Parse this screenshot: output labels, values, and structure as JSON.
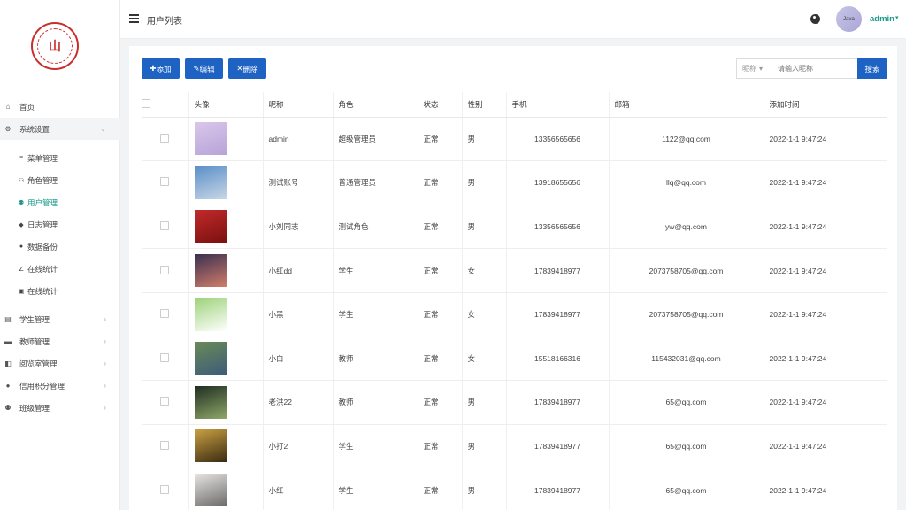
{
  "sidebar": {
    "logo_text": "山",
    "menu": [
      {
        "label": "首页",
        "icon": "home-icon",
        "glyph": "⌂",
        "has_arrow": false
      },
      {
        "label": "系统设置",
        "icon": "gear-icon",
        "glyph": "⚙",
        "has_arrow": true,
        "expanded": true
      }
    ],
    "sub_items": [
      {
        "label": "菜单管理",
        "icon": "list-icon",
        "glyph": "≡",
        "active": false
      },
      {
        "label": "角色管理",
        "icon": "user-group-icon",
        "glyph": "⚇",
        "active": false
      },
      {
        "label": "用户管理",
        "icon": "users-icon",
        "glyph": "⚉",
        "active": true
      },
      {
        "label": "日志管理",
        "icon": "tag-icon",
        "glyph": "◆",
        "active": false
      },
      {
        "label": "数据备份",
        "icon": "database-icon",
        "glyph": "●",
        "active": false
      },
      {
        "label": "在线统计",
        "icon": "chart-line-icon",
        "glyph": "∠",
        "active": false
      },
      {
        "label": "在线统计",
        "icon": "monitor-icon",
        "glyph": "▣",
        "active": false
      }
    ],
    "menu_after": [
      {
        "label": "学生管理",
        "icon": "student-icon",
        "glyph": "▤"
      },
      {
        "label": "教师管理",
        "icon": "teacher-icon",
        "glyph": "▬"
      },
      {
        "label": "阅览室管理",
        "icon": "room-icon",
        "glyph": "◧"
      },
      {
        "label": "信用积分管理",
        "icon": "person-icon",
        "glyph": "●"
      },
      {
        "label": "班级管理",
        "icon": "class-icon",
        "glyph": "⚉"
      }
    ]
  },
  "header": {
    "title": "用户列表",
    "avatar_text": "Java",
    "user": "admin"
  },
  "toolbar": {
    "add_label": "添加",
    "edit_label": "编辑",
    "delete_label": "删除",
    "search_field": "昵称",
    "search_placeholder": "请输入昵称",
    "search_label": "搜索"
  },
  "table": {
    "columns": [
      "头像",
      "昵称",
      "角色",
      "状态",
      "性别",
      "手机",
      "邮箱",
      "添加时间"
    ],
    "rows": [
      {
        "nickname": "admin",
        "role": "超级管理员",
        "status": "正常",
        "gender": "男",
        "phone": "13356565656",
        "email": "1122@qq.com",
        "time": "2022-1-1 9:47:24"
      },
      {
        "nickname": "测试账号",
        "role": "普通管理员",
        "status": "正常",
        "gender": "男",
        "phone": "13918655656",
        "email": "llq@qq.com",
        "time": "2022-1-1 9:47:24"
      },
      {
        "nickname": "小刘同志",
        "role": "测试角色",
        "status": "正常",
        "gender": "男",
        "phone": "13356565656",
        "email": "yw@qq.com",
        "time": "2022-1-1 9:47:24"
      },
      {
        "nickname": "小红dd",
        "role": "学生",
        "status": "正常",
        "gender": "女",
        "phone": "17839418977",
        "email": "2073758705@qq.com",
        "time": "2022-1-1 9:47:24"
      },
      {
        "nickname": "小黑",
        "role": "学生",
        "status": "正常",
        "gender": "女",
        "phone": "17839418977",
        "email": "2073758705@qq.com",
        "time": "2022-1-1 9:47:24"
      },
      {
        "nickname": "小白",
        "role": "教师",
        "status": "正常",
        "gender": "女",
        "phone": "15518166316",
        "email": "115432031@qq.com",
        "time": "2022-1-1 9:47:24"
      },
      {
        "nickname": "老洪22",
        "role": "教师",
        "status": "正常",
        "gender": "男",
        "phone": "17839418977",
        "email": "65@qq.com",
        "time": "2022-1-1 9:47:24"
      },
      {
        "nickname": "小打2",
        "role": "学生",
        "status": "正常",
        "gender": "男",
        "phone": "17839418977",
        "email": "65@qq.com",
        "time": "2022-1-1 9:47:24"
      },
      {
        "nickname": "小红",
        "role": "学生",
        "status": "正常",
        "gender": "男",
        "phone": "17839418977",
        "email": "65@qq.com",
        "time": "2022-1-1 9:47:24"
      }
    ],
    "thumb_colors": [
      [
        "#d9c7ea",
        "#b8a3d8"
      ],
      [
        "#5b8fc9",
        "#c9d7e6"
      ],
      [
        "#c22a2a",
        "#7a1010"
      ],
      [
        "#3a2f4f",
        "#d27d6a"
      ],
      [
        "#9ed27a",
        "#ffffff"
      ],
      [
        "#6a8a55",
        "#3d5c7a"
      ],
      [
        "#1f2d1f",
        "#8fa86a"
      ],
      [
        "#c9a042",
        "#3a2a12"
      ],
      [
        "#e8e4e0",
        "#6a6a6a"
      ]
    ]
  }
}
